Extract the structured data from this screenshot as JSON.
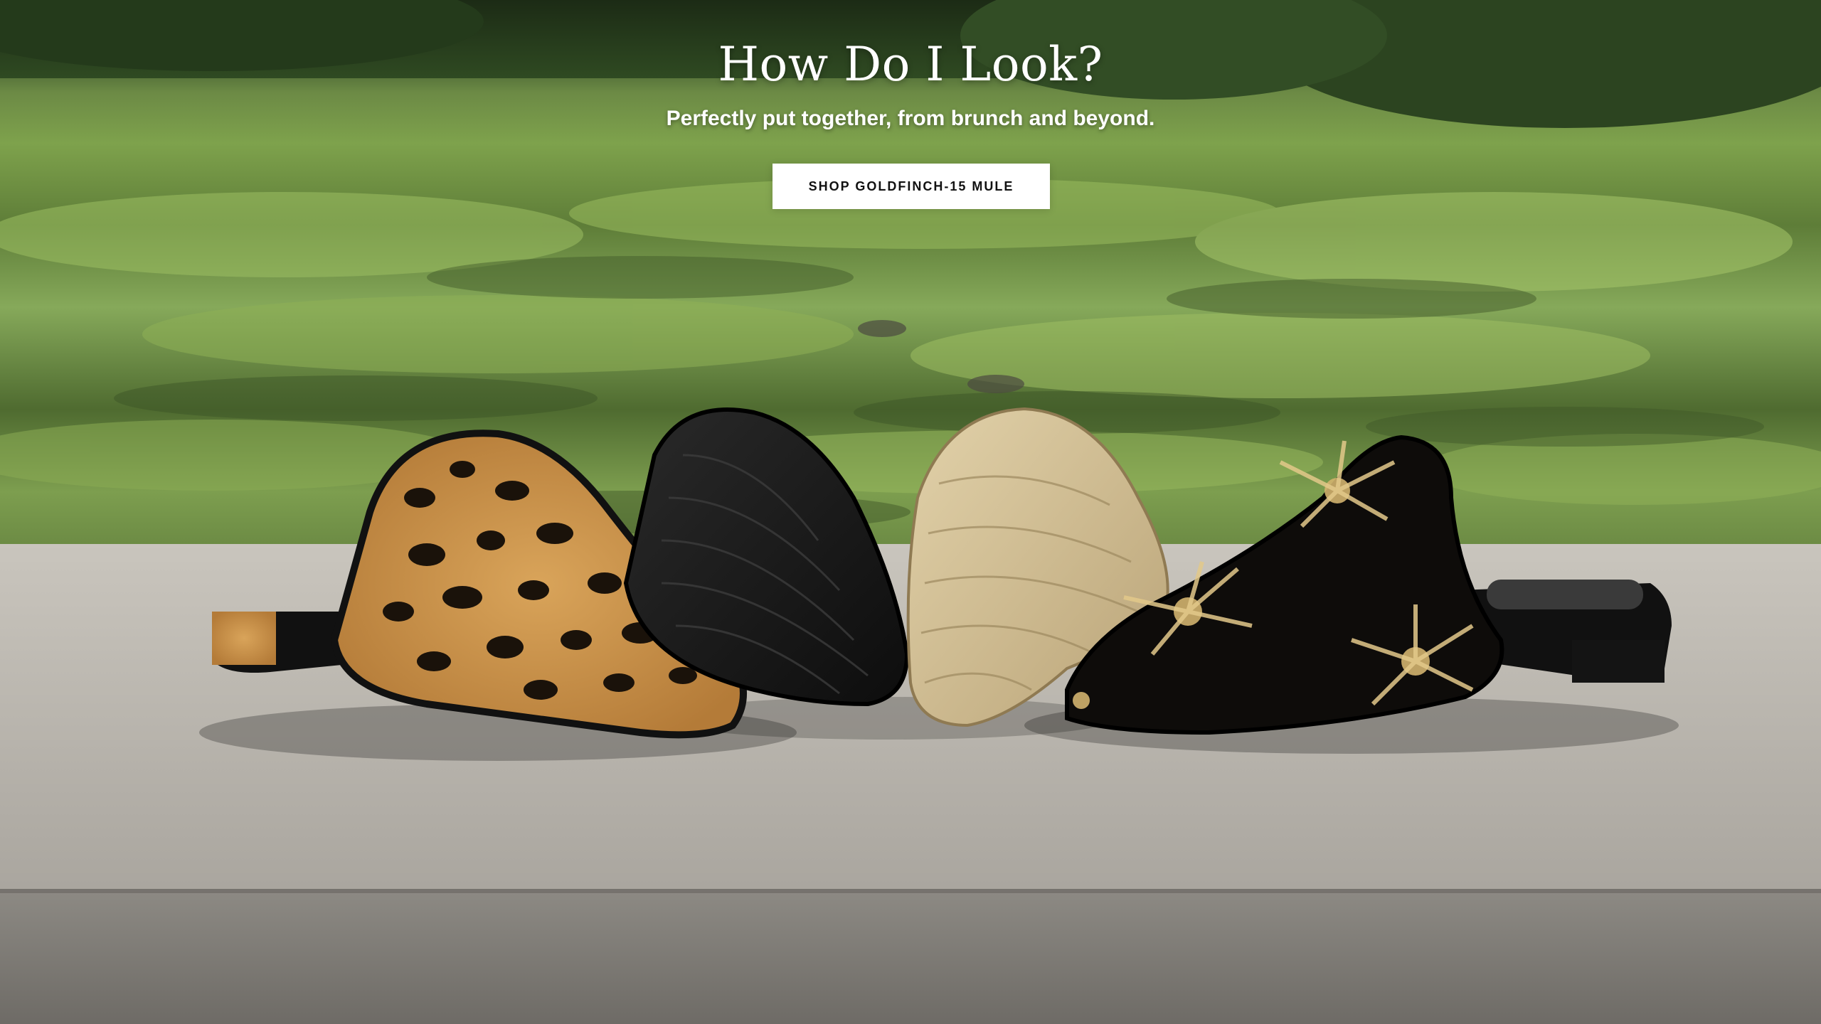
{
  "hero": {
    "title": "How Do I Look?",
    "subtitle": "Perfectly put together, from brunch and beyond.",
    "cta_label": "SHOP GOLDFINCH-15 MULE"
  },
  "colors": {
    "cta_background": "#ffffff",
    "cta_text": "#111111",
    "headline_text": "#ffffff",
    "pond_green": "#7ea24c",
    "stone_gray": "#b9b5ad"
  },
  "icons": []
}
